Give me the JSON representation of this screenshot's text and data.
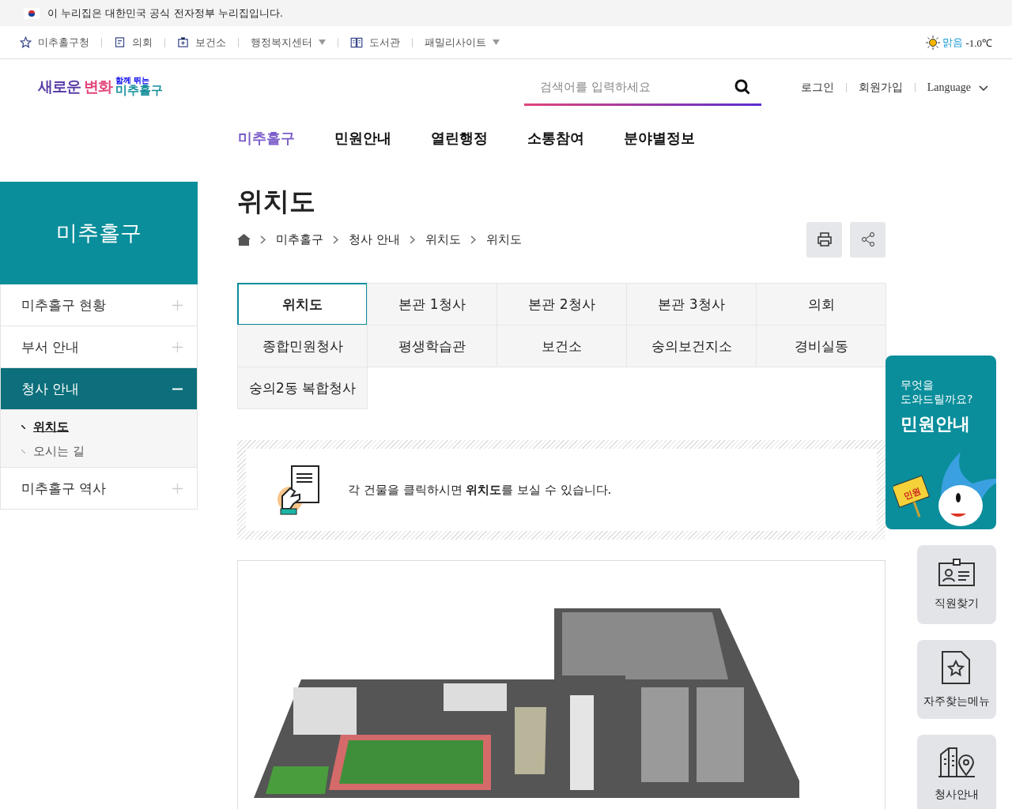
{
  "gov_banner": {
    "text": "이 누리집은 대한민국 공식 전자정부 누리집입니다."
  },
  "util_links": [
    {
      "label": "미추홀구청",
      "dropdown": false
    },
    {
      "label": "의회",
      "dropdown": false
    },
    {
      "label": "보건소",
      "dropdown": false
    },
    {
      "label": "행정복지센터",
      "dropdown": true
    },
    {
      "label": "도서관",
      "dropdown": false
    },
    {
      "label": "패밀리사이트",
      "dropdown": true
    }
  ],
  "weather": {
    "condition": "맑음",
    "temperature": "-1.0℃"
  },
  "logo": {
    "main_1": "새로운",
    "main_2": "변화",
    "sub": "함께 뛰는",
    "name": "미추홀구"
  },
  "search": {
    "placeholder": "검색어를 입력하세요"
  },
  "account_links": [
    "로그인",
    "회원가입"
  ],
  "language": "Language",
  "nav": [
    {
      "label": "미추홀구",
      "selected": true
    },
    {
      "label": "민원안내",
      "selected": false
    },
    {
      "label": "열린행정",
      "selected": false
    },
    {
      "label": "소통참여",
      "selected": false
    },
    {
      "label": "분야별정보",
      "selected": false
    }
  ],
  "sidebar": {
    "title": "미추홀구",
    "items": [
      {
        "label": "미추홀구 현황",
        "expanded": false,
        "selected": false
      },
      {
        "label": "부서 안내",
        "expanded": false,
        "selected": false
      },
      {
        "label": "청사 안내",
        "expanded": true,
        "selected": true,
        "children": [
          {
            "label": "위치도",
            "selected": true
          },
          {
            "label": "오시는 길",
            "selected": false
          }
        ]
      },
      {
        "label": "미추홀구 역사",
        "expanded": false,
        "selected": false
      }
    ]
  },
  "page_title": "위치도",
  "breadcrumb": [
    "미추홀구",
    "청사 안내",
    "위치도",
    "위치도"
  ],
  "tabs": [
    {
      "label": "위치도",
      "selected": true
    },
    {
      "label": "본관 1청사",
      "selected": false
    },
    {
      "label": "본관 2청사",
      "selected": false
    },
    {
      "label": "본관 3청사",
      "selected": false
    },
    {
      "label": "의회",
      "selected": false
    },
    {
      "label": "종합민원청사",
      "selected": false
    },
    {
      "label": "평생학습관",
      "selected": false
    },
    {
      "label": "보건소",
      "selected": false
    },
    {
      "label": "숭의보건지소",
      "selected": false
    },
    {
      "label": "경비실동",
      "selected": false
    },
    {
      "label": "숭의2동 복합청사",
      "selected": false
    }
  ],
  "notice": "각 건물을 클릭하시면 **위치도**를 보실 수 있습니다.",
  "quick": {
    "banner": {
      "question_lines": [
        "무엇을",
        "도와드릴까요?"
      ],
      "title": "민원안내",
      "sign": "민원"
    },
    "items": [
      "직원찾기",
      "자주찾는메뉴",
      "청사안내"
    ]
  }
}
